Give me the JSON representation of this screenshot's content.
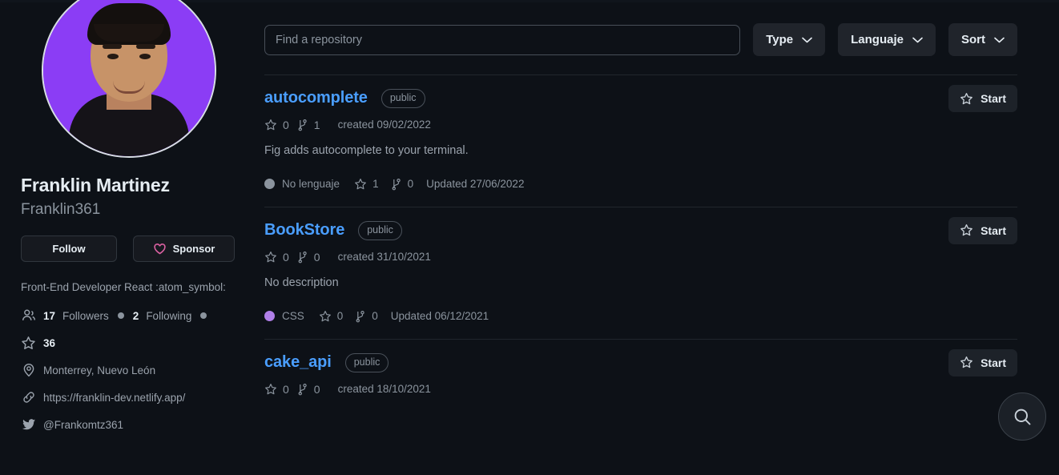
{
  "profile": {
    "avatar_alt": "user-avatar",
    "name": "Franklin Martinez",
    "login": "Franklin361",
    "follow_label": "Follow",
    "sponsor_label": "Sponsor",
    "bio": "Front-End Developer React :atom_symbol:",
    "followers_count": "17",
    "followers_label": "Followers",
    "following_count": "2",
    "following_label": "Following",
    "stars_count": "36",
    "location": "Monterrey, Nuevo León",
    "website": "https://franklin-dev.netlify.app/",
    "twitter": "@Frankomtz361"
  },
  "search": {
    "placeholder": "Find a repository",
    "value": ""
  },
  "filters": [
    {
      "label": "Type"
    },
    {
      "label": "Languaje"
    },
    {
      "label": "Sort"
    }
  ],
  "colors": {
    "link_blue": "#4a9eff",
    "heart_pink": "#db61a2",
    "css_dot": "#b07fe8",
    "no_lang_dot": "#8b949e",
    "background": "#0d1117",
    "divider": "#21262d"
  },
  "repos": [
    {
      "name": "autocomplete",
      "visibility": "public",
      "stars": "0",
      "forks": "1",
      "created": "created 09/02/2022",
      "description": "Fig adds autocomplete to your terminal.",
      "language": "No lenguaje",
      "language_color": "#8b949e",
      "footer_stars": "1",
      "footer_forks": "0",
      "updated": "Updated 27/06/2022",
      "start_label": "Start"
    },
    {
      "name": "BookStore",
      "visibility": "public",
      "stars": "0",
      "forks": "0",
      "created": "created 31/10/2021",
      "description": "No description",
      "language": "CSS",
      "language_color": "#b07fe8",
      "footer_stars": "0",
      "footer_forks": "0",
      "updated": "Updated 06/12/2021",
      "start_label": "Start"
    },
    {
      "name": "cake_api",
      "visibility": "public",
      "stars": "0",
      "forks": "0",
      "created": "created 18/10/2021",
      "description": "",
      "language": "",
      "language_color": "",
      "footer_stars": "",
      "footer_forks": "",
      "updated": "",
      "start_label": "Start"
    }
  ],
  "fab": {
    "icon": "search-icon"
  }
}
